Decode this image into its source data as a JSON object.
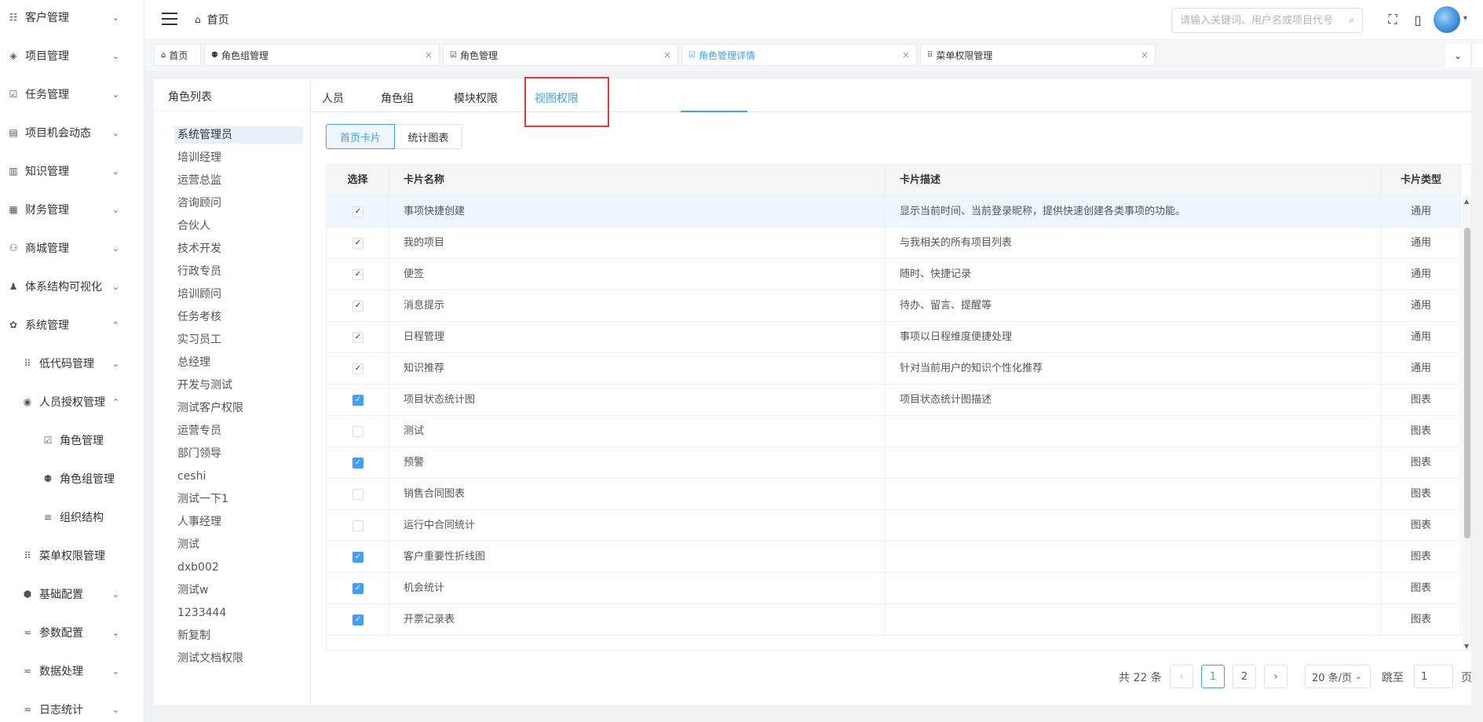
{
  "sidebar": {
    "items": [
      {
        "label": "客户管理",
        "icon": "customer-icon",
        "glyph": "☷",
        "arrow": "⌄",
        "level": 0
      },
      {
        "label": "项目管理",
        "icon": "layers-icon",
        "glyph": "◈",
        "arrow": "⌄",
        "level": 0
      },
      {
        "label": "任务管理",
        "icon": "task-check-icon",
        "glyph": "☑",
        "arrow": "⌄",
        "level": 0
      },
      {
        "label": "项目机会动态",
        "icon": "calendar-icon",
        "glyph": "▤",
        "arrow": "⌄",
        "level": 0
      },
      {
        "label": "知识管理",
        "icon": "book-icon",
        "glyph": "▥",
        "arrow": "⌄",
        "level": 0
      },
      {
        "label": "财务管理",
        "icon": "grid-icon",
        "glyph": "▦",
        "arrow": "⌄",
        "level": 0
      },
      {
        "label": "商城管理",
        "icon": "shop-icon",
        "glyph": "⚇",
        "arrow": "⌄",
        "level": 0
      },
      {
        "label": "体系结构可视化",
        "icon": "org-icon",
        "glyph": "♟",
        "arrow": "⌄",
        "level": 0
      },
      {
        "label": "系统管理",
        "icon": "gear-icon",
        "glyph": "✿",
        "arrow": "⌃",
        "level": 0
      },
      {
        "label": "低代码管理",
        "icon": "apps-icon",
        "glyph": "⠿",
        "arrow": "⌄",
        "level": 1
      },
      {
        "label": "人员授权管理",
        "icon": "user-circle-icon",
        "glyph": "◉",
        "arrow": "⌃",
        "level": 1
      },
      {
        "label": "角色管理",
        "icon": "checkbox-icon",
        "glyph": "☑",
        "arrow": "",
        "level": 2
      },
      {
        "label": "角色组管理",
        "icon": "group-icon",
        "glyph": "⚉",
        "arrow": "",
        "level": 2
      },
      {
        "label": "组织结构",
        "icon": "list-icon",
        "glyph": "≡",
        "arrow": "",
        "level": 2
      },
      {
        "label": "菜单权限管理",
        "icon": "apps-icon",
        "glyph": "⠿",
        "arrow": "",
        "level": 1
      },
      {
        "label": "基础配置",
        "icon": "cube-icon",
        "glyph": "⬢",
        "arrow": "⌄",
        "level": 1
      },
      {
        "label": "参数配置",
        "icon": "filter-icon",
        "glyph": "≂",
        "arrow": "⌄",
        "level": 1
      },
      {
        "label": "数据处理",
        "icon": "filter-icon",
        "glyph": "≂",
        "arrow": "⌄",
        "level": 1
      },
      {
        "label": "日志统计",
        "icon": "filter-icon",
        "glyph": "≂",
        "arrow": "⌄",
        "level": 1
      }
    ]
  },
  "header": {
    "breadcrumb": "首页",
    "search_placeholder": "请输入关键词、用户名或项目代号"
  },
  "tagbar": {
    "tags": [
      {
        "label": "首页",
        "icon": "⌂",
        "closable": false,
        "active": false
      },
      {
        "label": "角色组管理",
        "icon": "⚉",
        "closable": true,
        "active": false
      },
      {
        "label": "角色管理",
        "icon": "☑",
        "closable": true,
        "active": false
      },
      {
        "label": "角色管理详情",
        "icon": "☑",
        "closable": true,
        "active": true
      },
      {
        "label": "菜单权限管理",
        "icon": "⠿",
        "closable": true,
        "active": false
      }
    ],
    "close_glyph": "×"
  },
  "roles": {
    "title": "角色列表",
    "items": [
      "系统管理员",
      "培训经理",
      "运营总监",
      "咨询顾问",
      "合伙人",
      "技术开发",
      "行政专员",
      "培训顾问",
      "任务考核",
      "实习员工",
      "总经理",
      "开发与测试",
      "测试客户权限",
      "运营专员",
      "部门领导",
      "ceshi",
      "测试一下1",
      "人事经理",
      "测试",
      "dxb002",
      "测试w",
      "1233444",
      "新复制",
      "测试文档权限"
    ],
    "selected": "系统管理员"
  },
  "tabs": {
    "items": [
      "人员",
      "角色组",
      "模块权限",
      "视图权限"
    ],
    "active": "视图权限"
  },
  "segments": {
    "items": [
      "首页卡片",
      "统计图表"
    ],
    "active": "首页卡片"
  },
  "table": {
    "columns": [
      "选择",
      "卡片名称",
      "卡片描述",
      "卡片类型"
    ],
    "rows": [
      {
        "name": "事项快捷创建",
        "desc": "显示当前时间、当前登录昵称，提供快速创建各类事项的功能。",
        "type": "通用",
        "checked": true,
        "style": "plain"
      },
      {
        "name": "我的项目",
        "desc": "与我相关的所有项目列表",
        "type": "通用",
        "checked": true,
        "style": "plain"
      },
      {
        "name": "便签",
        "desc": "随时、快捷记录",
        "type": "通用",
        "checked": true,
        "style": "plain"
      },
      {
        "name": "消息提示",
        "desc": "待办、留言、提醒等",
        "type": "通用",
        "checked": true,
        "style": "plain"
      },
      {
        "name": "日程管理",
        "desc": "事项以日程维度便捷处理",
        "type": "通用",
        "checked": true,
        "style": "plain"
      },
      {
        "name": "知识推荐",
        "desc": "针对当前用户的知识个性化推荐",
        "type": "通用",
        "checked": true,
        "style": "plain"
      },
      {
        "name": "项目状态统计图",
        "desc": "项目状态统计图描述",
        "type": "图表",
        "checked": true,
        "style": "primary"
      },
      {
        "name": "测试",
        "desc": "",
        "type": "图表",
        "checked": false,
        "style": "primary"
      },
      {
        "name": "预警",
        "desc": "",
        "type": "图表",
        "checked": true,
        "style": "primary"
      },
      {
        "name": "销售合同图表",
        "desc": "",
        "type": "图表",
        "checked": false,
        "style": "primary"
      },
      {
        "name": "运行中合同统计",
        "desc": "",
        "type": "图表",
        "checked": false,
        "style": "primary"
      },
      {
        "name": "客户重要性折线图",
        "desc": "",
        "type": "图表",
        "checked": true,
        "style": "primary"
      },
      {
        "name": "机会统计",
        "desc": "",
        "type": "图表",
        "checked": true,
        "style": "primary"
      },
      {
        "name": "开票记录表",
        "desc": "",
        "type": "图表",
        "checked": true,
        "style": "primary"
      }
    ],
    "check_glyph": "✓"
  },
  "pagination": {
    "total_text": "共 22 条",
    "pages": [
      "1",
      "2"
    ],
    "current": "1",
    "prev": "‹",
    "next": "›",
    "page_size": "20 条/页",
    "jump_label": "跳至",
    "jump_value": "1",
    "page_unit": "页"
  },
  "colors": {
    "accent": "#409eff",
    "highlight_border": "#e53935"
  }
}
